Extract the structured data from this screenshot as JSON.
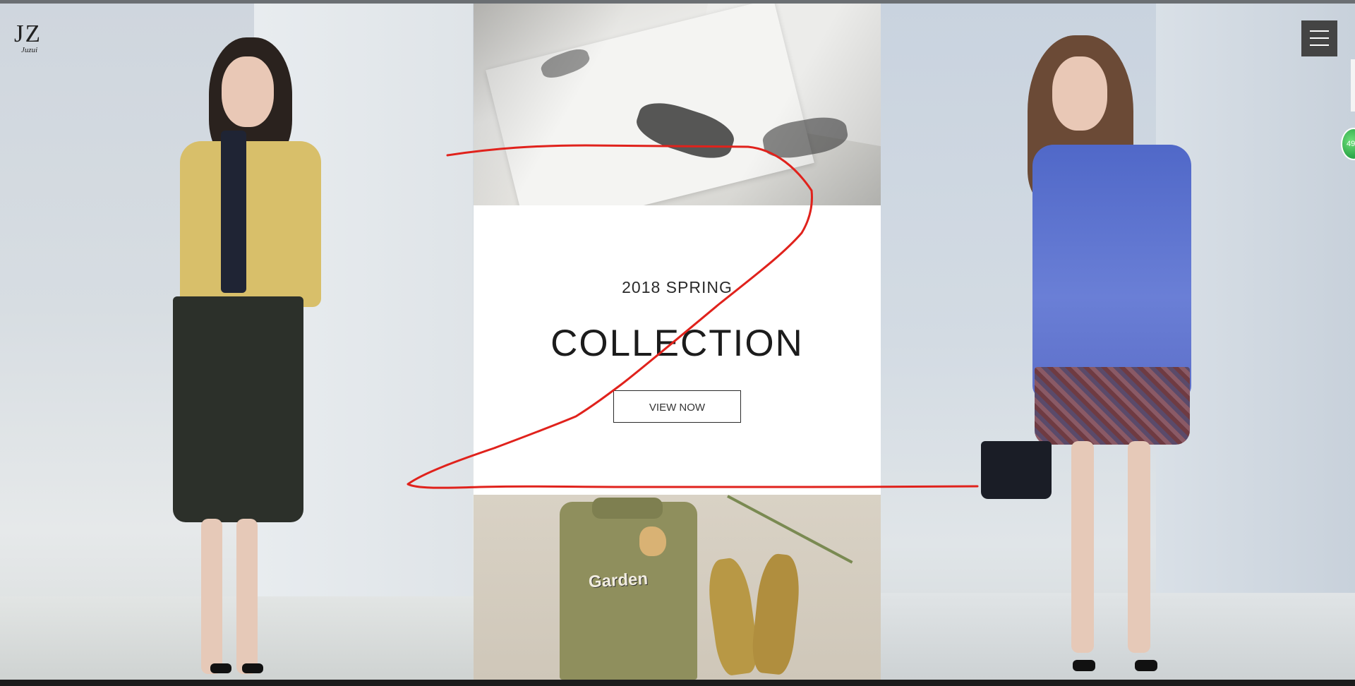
{
  "brand": {
    "logo_mark": "JZ",
    "logo_script": "Juzui"
  },
  "promo": {
    "season": "2018 SPRING",
    "title": "COLLECTION",
    "cta": "VIEW NOW"
  },
  "flatlay": {
    "shirt_text": "Garden"
  },
  "side_badge": {
    "count": "49"
  },
  "icons": {
    "menu": "hamburger-menu-icon"
  },
  "colors": {
    "menu_bg": "#444444",
    "annotation_stroke": "#e0221c",
    "badge_green": "#2ea84a"
  }
}
